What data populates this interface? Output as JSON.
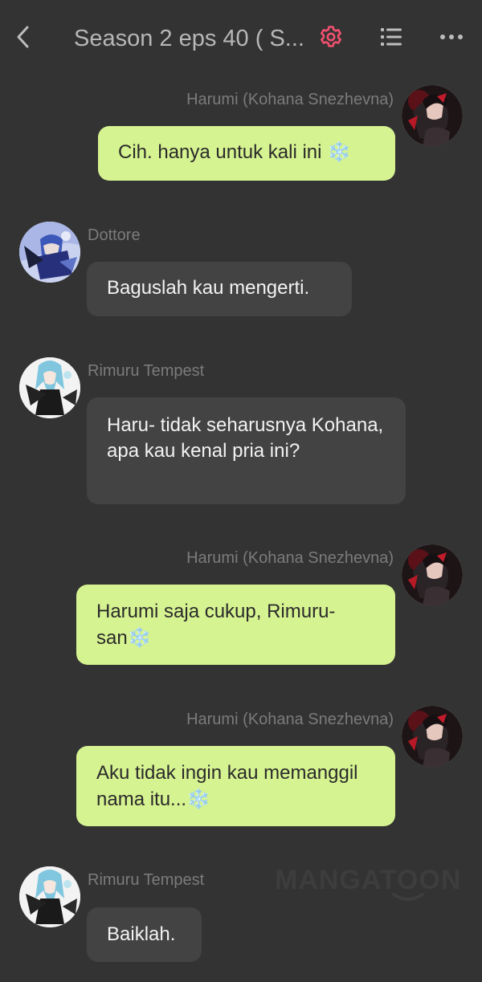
{
  "header": {
    "title": "Season 2 eps 40 ( S...",
    "back_icon": "chevron-left-icon",
    "settings_icon": "gear-icon",
    "list_icon": "list-icon",
    "more_icon": "more-horizontal-icon",
    "accent_color": "#f0506e"
  },
  "messages": [
    {
      "sender": "Harumi (Kohana Snezhevna)",
      "side": "right",
      "text": "Cih. hanya untuk kali ini",
      "emoji": "❄️"
    },
    {
      "sender": "Dottore",
      "side": "left",
      "text": "Baguslah kau mengerti.",
      "emoji": ""
    },
    {
      "sender": "Rimuru Tempest",
      "side": "left",
      "text": "Haru- tidak seharusnya Kohana, apa kau kenal pria ini?",
      "emoji": ""
    },
    {
      "sender": "Harumi (Kohana Snezhevna)",
      "side": "right",
      "text": "Harumi saja cukup, Rimuru-san",
      "emoji": "❄️"
    },
    {
      "sender": "Harumi (Kohana Snezhevna)",
      "side": "right",
      "text": "Aku tidak ingin kau memanggil nama itu...",
      "emoji": "❄️"
    },
    {
      "sender": "Rimuru Tempest",
      "side": "left",
      "text": "Baiklah.",
      "emoji": ""
    }
  ],
  "watermark": "MANGATOON",
  "colors": {
    "background": "#333333",
    "my_bubble": "#d6f391",
    "their_bubble": "#434343",
    "sender_name": "#7b7b7b"
  }
}
